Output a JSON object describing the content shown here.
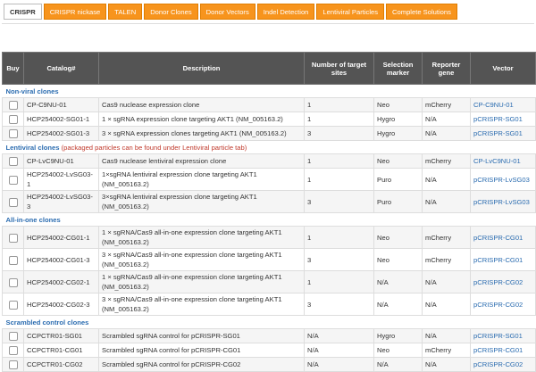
{
  "tabs": [
    "CRISPR",
    "CRISPR nickase",
    "TALEN",
    "Donor Clones",
    "Donor Vectors",
    "Indel Detection",
    "Lentiviral Particles",
    "Complete Solutions"
  ],
  "active_tab": 0,
  "table": {
    "headers": [
      "Buy",
      "Catalog#",
      "Description",
      "Number of target sites",
      "Selection marker",
      "Reporter gene",
      "Vector"
    ],
    "sections": [
      {
        "title": "Non-viral clones",
        "note": "",
        "rows": [
          {
            "catalog": "CP-C9NU-01",
            "desc": "Cas9 nuclease expression clone",
            "sites": "1",
            "marker": "Neo",
            "reporter": "mCherry",
            "vector": "CP-C9NU-01"
          },
          {
            "catalog": "HCP254002-SG01-1",
            "desc": "1 × sgRNA expression clone targeting AKT1 (NM_005163.2)",
            "sites": "1",
            "marker": "Hygro",
            "reporter": "N/A",
            "vector": "pCRISPR-SG01"
          },
          {
            "catalog": "HCP254002-SG01-3",
            "desc": "3 × sgRNA expression clones targeting AKT1 (NM_005163.2)",
            "sites": "3",
            "marker": "Hygro",
            "reporter": "N/A",
            "vector": "pCRISPR-SG01"
          }
        ]
      },
      {
        "title": "Lentiviral clones",
        "note": "(packaged particles can be found under Lentiviral particle tab)",
        "rows": [
          {
            "catalog": "CP-LvC9NU-01",
            "desc": "Cas9 nuclease lentiviral expression clone",
            "sites": "1",
            "marker": "Neo",
            "reporter": "mCherry",
            "vector": "CP-LvC9NU-01"
          },
          {
            "catalog": "HCP254002-LvSG03-1",
            "desc": "1×sgRNA lentiviral expression clone targeting AKT1 (NM_005163.2)",
            "sites": "1",
            "marker": "Puro",
            "reporter": "N/A",
            "vector": "pCRISPR-LvSG03"
          },
          {
            "catalog": "HCP254002-LvSG03-3",
            "desc": "3×sgRNA lentiviral expression clone targeting AKT1 (NM_005163.2)",
            "sites": "3",
            "marker": "Puro",
            "reporter": "N/A",
            "vector": "pCRISPR-LvSG03"
          }
        ]
      },
      {
        "title": "All-in-one clones",
        "note": "",
        "rows": [
          {
            "catalog": "HCP254002-CG01-1",
            "desc": "1 × sgRNA/Cas9 all-in-one expression clone targeting AKT1 (NM_005163.2)",
            "sites": "1",
            "marker": "Neo",
            "reporter": "mCherry",
            "vector": "pCRISPR-CG01"
          },
          {
            "catalog": "HCP254002-CG01-3",
            "desc": "3 × sgRNA/Cas9 all-in-one expression clone targeting AKT1 (NM_005163.2)",
            "sites": "3",
            "marker": "Neo",
            "reporter": "mCherry",
            "vector": "pCRISPR-CG01"
          },
          {
            "catalog": "HCP254002-CG02-1",
            "desc": "1 × sgRNA/Cas9 all-in-one expression clone targeting AKT1 (NM_005163.2)",
            "sites": "1",
            "marker": "N/A",
            "reporter": "N/A",
            "vector": "pCRISPR-CG02"
          },
          {
            "catalog": "HCP254002-CG02-3",
            "desc": "3 × sgRNA/Cas9 all-in-one expression clone targeting AKT1 (NM_005163.2)",
            "sites": "3",
            "marker": "N/A",
            "reporter": "N/A",
            "vector": "pCRISPR-CG02"
          }
        ]
      },
      {
        "title": "Scrambled control clones",
        "note": "",
        "rows": [
          {
            "catalog": "CCPCTR01-SG01",
            "desc": "Scrambled sgRNA control for pCRISPR-SG01",
            "sites": "N/A",
            "marker": "Hygro",
            "reporter": "N/A",
            "vector": "pCRISPR-SG01"
          },
          {
            "catalog": "CCPCTR01-CG01",
            "desc": "Scrambled sgRNA control for pCRISPR-CG01",
            "sites": "N/A",
            "marker": "Neo",
            "reporter": "mCherry",
            "vector": "pCRISPR-CG01"
          },
          {
            "catalog": "CCPCTR01-CG02",
            "desc": "Scrambled sgRNA control for pCRISPR-CG02",
            "sites": "N/A",
            "marker": "N/A",
            "reporter": "N/A",
            "vector": "pCRISPR-CG02"
          }
        ]
      }
    ]
  },
  "colors": {
    "tab_orange": "#f7941d",
    "header_bg": "#545454",
    "link": "#2b6cb0",
    "note_red": "#c0392b"
  }
}
